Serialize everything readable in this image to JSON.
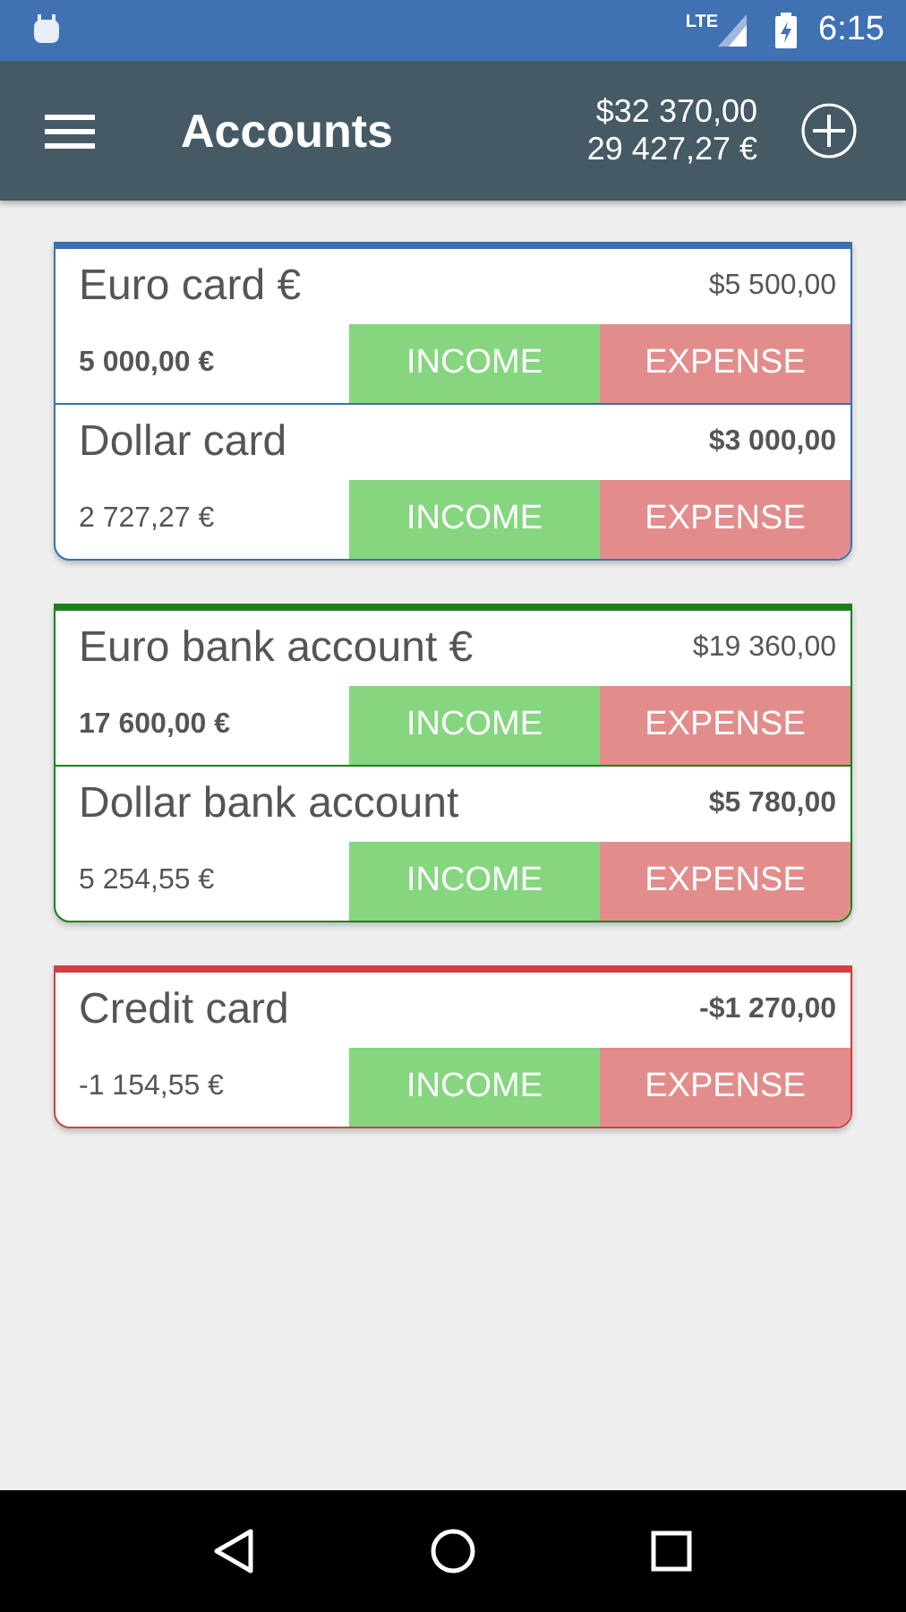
{
  "status_bar": {
    "network": "LTE",
    "time": "6:15"
  },
  "app_bar": {
    "title": "Accounts",
    "total_usd": "$32 370,00",
    "total_eur": "29 427,27 €"
  },
  "groups": [
    {
      "color": "#3a6fb0",
      "accounts": [
        {
          "name": "Euro card €",
          "usd": {
            "text": "$5 500,00",
            "bold": false
          },
          "eur": {
            "text": "5 000,00 €",
            "bold": true
          },
          "income": "INCOME",
          "expense": "EXPENSE"
        },
        {
          "name": "Dollar card",
          "usd": {
            "text": "$3 000,00",
            "bold": true
          },
          "eur": {
            "text": "2 727,27 €",
            "bold": false
          },
          "income": "INCOME",
          "expense": "EXPENSE"
        }
      ]
    },
    {
      "color": "#1e7f1e",
      "accounts": [
        {
          "name": "Euro bank account €",
          "usd": {
            "text": "$19 360,00",
            "bold": false
          },
          "eur": {
            "text": "17 600,00 €",
            "bold": true
          },
          "income": "INCOME",
          "expense": "EXPENSE"
        },
        {
          "name": "Dollar bank account",
          "usd": {
            "text": "$5 780,00",
            "bold": true
          },
          "eur": {
            "text": "5 254,55 €",
            "bold": false
          },
          "income": "INCOME",
          "expense": "EXPENSE"
        }
      ]
    },
    {
      "color": "#d04040",
      "accounts": [
        {
          "name": "Credit card",
          "usd": {
            "text": "-$1 270,00",
            "bold": true
          },
          "eur": {
            "text": "-1 154,55 €",
            "bold": false
          },
          "income": "INCOME",
          "expense": "EXPENSE"
        }
      ]
    }
  ]
}
